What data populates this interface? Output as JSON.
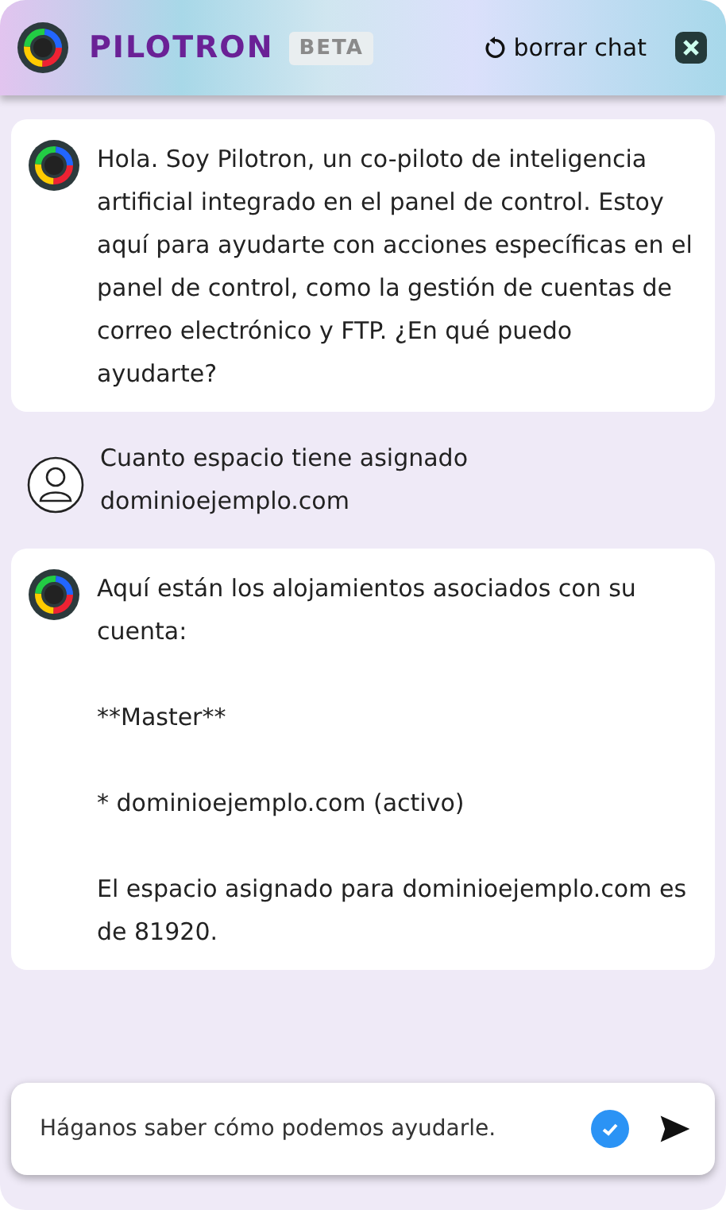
{
  "header": {
    "title": "PILOTRON",
    "badge": "BETA",
    "clear_button": "borrar chat"
  },
  "messages": [
    {
      "kind": "bot",
      "paragraphs": [
        "Hola. Soy Pilotron, un co-piloto de inteligencia artificial integrado en el panel de control. Estoy aquí para ayudarte con acciones específicas en el panel de control, como la gestión de cuentas de correo electrónico y FTP. ¿En qué puedo ayudarte?"
      ]
    },
    {
      "kind": "user",
      "paragraphs": [
        "Cuanto espacio tiene asignado dominioejemplo.com"
      ]
    },
    {
      "kind": "bot",
      "paragraphs": [
        "Aquí están los alojamientos asociados con su cuenta:",
        "**Master**",
        "* dominioejemplo.com (activo)",
        "El espacio asignado para dominioejemplo.com es de 81920."
      ]
    }
  ],
  "composer": {
    "placeholder": "Háganos saber cómo podemos ayudarle."
  }
}
